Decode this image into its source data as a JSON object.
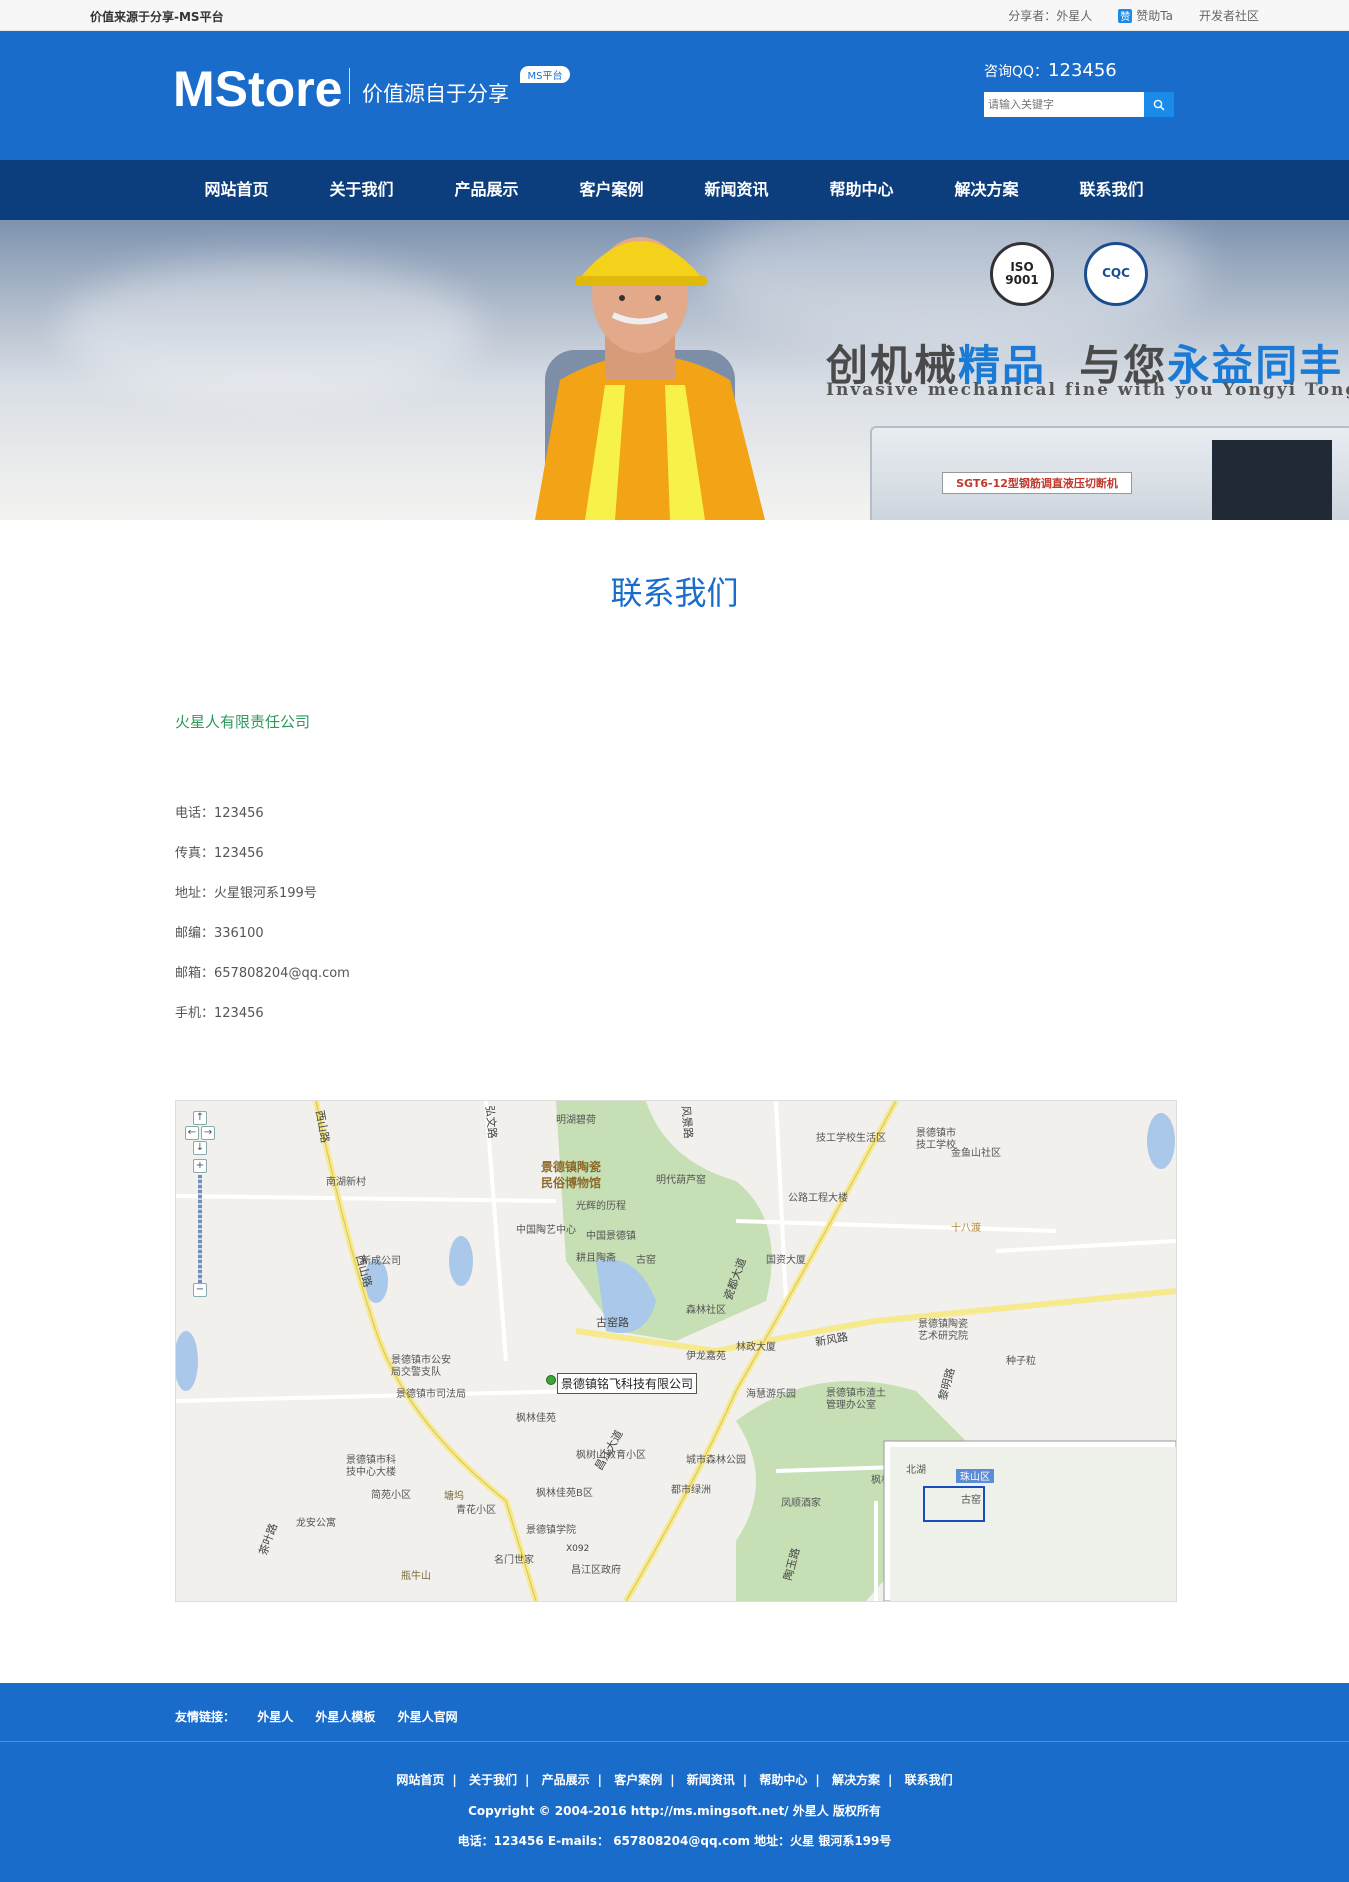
{
  "topbar": {
    "left_text": "价值来源于分享-MS平台",
    "share_label": "分享者：外星人",
    "sponsor_label": "赞助Ta",
    "community_label": "开发者社区"
  },
  "header": {
    "logo": "MStore",
    "slogan": "价值源自于分享",
    "badge": "MS平台",
    "qq_label": "咨询QQ：",
    "qq_value": "123456",
    "search_placeholder": "请输入关键字"
  },
  "nav": {
    "items": [
      "网站首页",
      "关于我们",
      "产品展示",
      "客户案例",
      "新闻资讯",
      "帮助中心",
      "解决方案",
      "联系我们"
    ]
  },
  "banner": {
    "headline_a": "创机械",
    "headline_b": "精品",
    "headline_c": "与您",
    "headline_d": "永益同丰",
    "sub": "Invasive mechanical fine with you Yongyi TongFeng",
    "cert1": "ISO 9001",
    "cert2": "CQC",
    "machine_plate": "SGT6-12型钢筋调直液压切断机"
  },
  "contact": {
    "title": "联系我们",
    "company": "火星人有限责任公司",
    "phone": "电话：123456",
    "fax": "传真：123456",
    "address": "地址：火星银河系199号",
    "zip": "邮编：336100",
    "email": "邮箱：657808204@qq.com",
    "mobile": "手机：123456"
  },
  "map": {
    "marker_label": "景德镇铭飞科技有限公司",
    "places": [
      "明湖碧荷",
      "景德镇陶瓷民俗博物馆",
      "光辉的历程",
      "明代葫芦窑",
      "中国陶艺中心",
      "中国景德镇",
      "耕且陶斋",
      "古窑",
      "南湖新村",
      "新成公司",
      "森林社区",
      "伊龙嘉苑",
      "林政大厦",
      "海慧游乐园",
      "景德镇市公安局交警支队",
      "景德镇市司法局",
      "枫林佳苑",
      "枫树山教育小区",
      "城市森林公园",
      "都市绿洲",
      "枫林佳苑B区",
      "景德镇学院",
      "青花小区",
      "简苑小区",
      "龙安公寓",
      "名门世家",
      "昌江区政府",
      "景德镇市科技中心大楼",
      "景德镇市技工学校",
      "技工学校生活区",
      "金鱼山社区",
      "公路工程大楼",
      "国资大厦",
      "景德镇陶瓷艺术研究院",
      "种子粒",
      "景德镇市渣土管理办公室",
      "枫林超市",
      "凤顺酒家",
      "十八渡",
      "塘坞",
      "瓶牛山",
      "北湖",
      "珠山区",
      "古窑"
    ],
    "roads": [
      "西山路",
      "弘文路",
      "风景路",
      "新风路",
      "古窑路",
      "瓷都大道",
      "黎明路",
      "昌江大道",
      "X092",
      "茶叶路",
      "陶玉路"
    ]
  },
  "footer": {
    "links_label": "友情链接：",
    "links": [
      "外星人",
      "外星人模板",
      "外星人官网"
    ],
    "nav": [
      "网站首页",
      "关于我们",
      "产品展示",
      "客户案例",
      "新闻资讯",
      "帮助中心",
      "解决方案",
      "联系我们"
    ],
    "copyright": "Copyright © 2004-2016 http://ms.mingsoft.net/ 外星人 版权所有",
    "address_line": "电话：123456 E-mails： 657808204@qq.com 地址：火星 银河系199号"
  }
}
